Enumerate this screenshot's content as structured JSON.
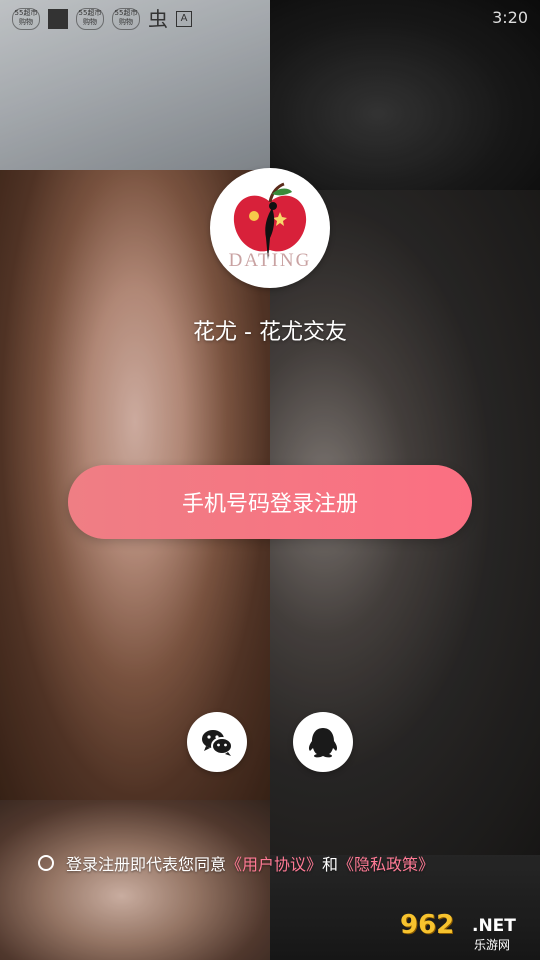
{
  "status_bar": {
    "badges": [
      "55超市购物",
      "55超市购物",
      "55超市购物"
    ],
    "glyph": "虫",
    "letter": "A",
    "time": "3:20"
  },
  "logo": {
    "text": "DATING"
  },
  "app_title": "花尤 - 花尤交友",
  "phone_login_button": "手机号码登录注册",
  "social_login": {
    "wechat_icon": "wechat-icon",
    "qq_icon": "qq-icon"
  },
  "agreement": {
    "prefix": "登录注册即代表您同意",
    "user_agreement": "《用户协议》",
    "and": "和",
    "privacy_policy": "《隐私政策》"
  },
  "watermark": {
    "number": "962",
    "net": ".NET",
    "sub": "乐游网"
  },
  "colors": {
    "button_gradient_start": "#ef7e84",
    "button_gradient_end": "#fb6f82",
    "link": "#ff7a95"
  }
}
